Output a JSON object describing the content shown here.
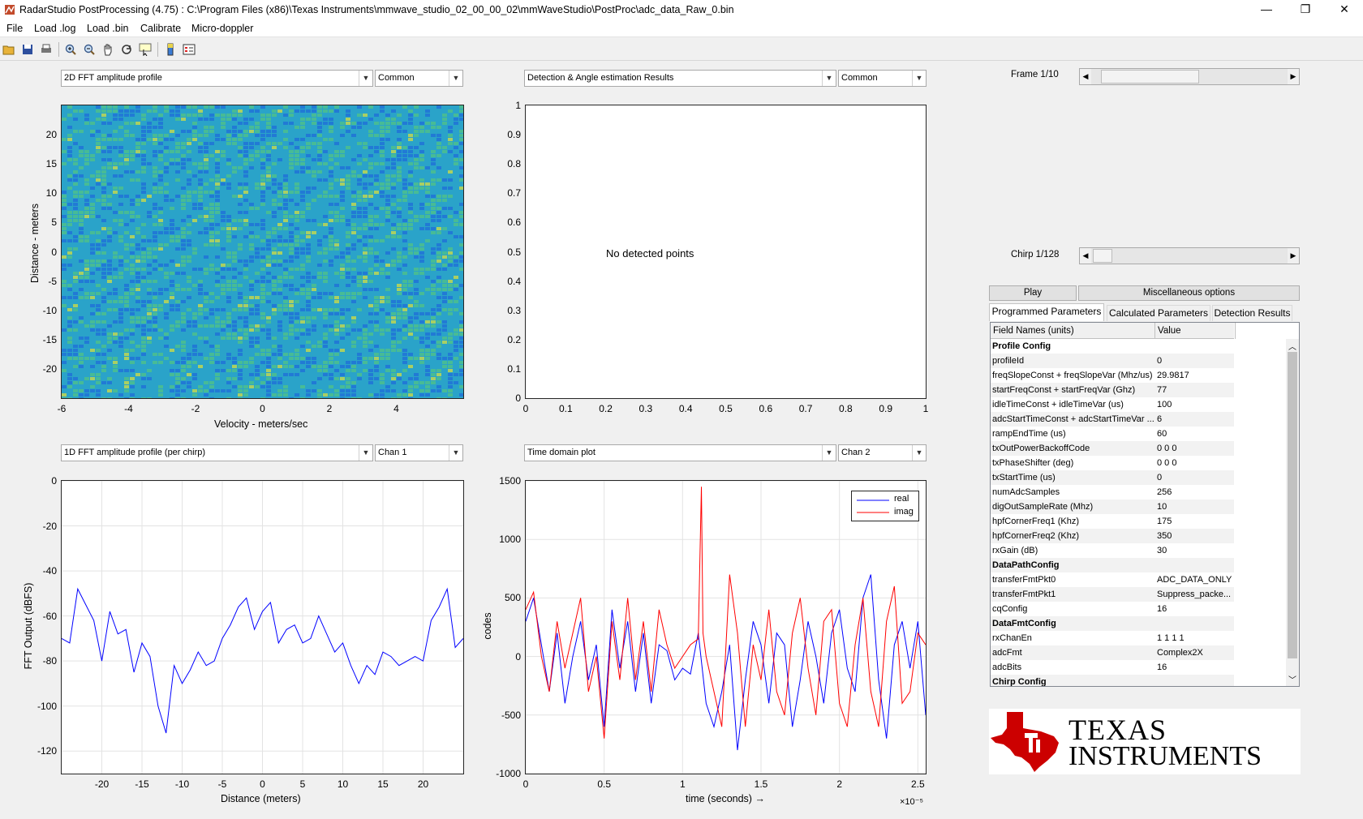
{
  "window": {
    "title": "RadarStudio PostProcessing (4.75)  : C:\\Program Files (x86)\\Texas Instruments\\mmwave_studio_02_00_00_02\\mmWaveStudio\\PostProc\\adc_data_Raw_0.bin",
    "minimize": "—",
    "restore": "❐",
    "close": "✕"
  },
  "menu": [
    "File",
    "Load .log",
    "Load .bin",
    "Calibrate",
    "Micro-doppler"
  ],
  "toolbar": [
    "open-icon",
    "save-icon",
    "print-icon",
    "zoom-in-icon",
    "zoom-out-icon",
    "pan-icon",
    "rotate-icon",
    "data-cursor-icon",
    "colorbar-icon",
    "legend-icon"
  ],
  "panels": {
    "tl": {
      "select": "2D FFT amplitude profile",
      "mode": "Common"
    },
    "tr": {
      "select": "Detection & Angle estimation Results",
      "mode": "Common"
    },
    "bl": {
      "select": "1D FFT amplitude profile (per chirp)",
      "mode": "Chan 1"
    },
    "br": {
      "select": "Time domain plot",
      "mode": "Chan 2"
    }
  },
  "chart_data": [
    {
      "type": "heatmap",
      "title": "",
      "xlabel": "Velocity - meters/sec",
      "ylabel": "Distance - meters",
      "xlim": [
        -6,
        6
      ],
      "ylim": [
        -25,
        25
      ],
      "xticks": [
        -6,
        -4,
        -2,
        0,
        2,
        4
      ],
      "yticks": [
        20,
        15,
        10,
        5,
        0,
        -5,
        -10,
        -15,
        -20
      ],
      "colormap": [
        "#1f6fd8",
        "#2aa3c9",
        "#4fc08a",
        "#c9d94a"
      ]
    },
    {
      "type": "scatter",
      "title": "",
      "annotation": "No detected points",
      "xlim": [
        0,
        1
      ],
      "ylim": [
        0,
        1
      ],
      "xticks": [
        0,
        0.1,
        0.2,
        0.3,
        0.4,
        0.5,
        0.6,
        0.7,
        0.8,
        0.9,
        1
      ],
      "yticks": [
        1,
        0.9,
        0.8,
        0.7,
        0.6,
        0.5,
        0.4,
        0.3,
        0.2,
        0.1,
        0
      ],
      "points": []
    },
    {
      "type": "line",
      "xlabel": "Distance (meters)",
      "ylabel": "FFT Output (dBFS)",
      "xlim": [
        -25,
        25
      ],
      "ylim": [
        -130,
        0
      ],
      "xticks": [
        -20,
        -15,
        -10,
        -5,
        0,
        5,
        10,
        15,
        20
      ],
      "yticks": [
        0,
        -20,
        -40,
        -60,
        -80,
        -100,
        -120
      ],
      "grid": true,
      "series": [
        {
          "color": "#0000ff",
          "x": [
            -25,
            -24,
            -23,
            -22,
            -21,
            -20,
            -19,
            -18,
            -17,
            -16,
            -15,
            -14,
            -13,
            -12,
            -11,
            -10,
            -9,
            -8,
            -7,
            -6,
            -5,
            -4,
            -3,
            -2,
            -1,
            0,
            1,
            2,
            3,
            4,
            5,
            6,
            7,
            8,
            9,
            10,
            11,
            12,
            13,
            14,
            15,
            16,
            17,
            18,
            19,
            20,
            21,
            22,
            23,
            24,
            25
          ],
          "values": [
            -70,
            -72,
            -48,
            -55,
            -62,
            -80,
            -58,
            -68,
            -66,
            -85,
            -72,
            -78,
            -100,
            -112,
            -82,
            -90,
            -84,
            -76,
            -82,
            -80,
            -70,
            -64,
            -56,
            -52,
            -66,
            -58,
            -54,
            -72,
            -66,
            -64,
            -72,
            -70,
            -60,
            -68,
            -76,
            -72,
            -82,
            -90,
            -82,
            -86,
            -76,
            -78,
            -82,
            -80,
            -78,
            -80,
            -62,
            -56,
            -48,
            -74,
            -70
          ]
        }
      ]
    },
    {
      "type": "line",
      "xlabel": "time  (seconds) →",
      "ylabel": "codes",
      "x_multiplier": "×10⁻⁵",
      "xlim": [
        0,
        2.55
      ],
      "ylim": [
        -1000,
        1500
      ],
      "xticks": [
        0,
        0.5,
        1,
        1.5,
        2,
        2.5
      ],
      "yticks": [
        1500,
        1000,
        500,
        0,
        -500,
        -1000
      ],
      "grid": true,
      "legend": "top-right",
      "series": [
        {
          "name": "real",
          "color": "#0000ff",
          "x": [
            0,
            0.05,
            0.1,
            0.15,
            0.2,
            0.25,
            0.3,
            0.35,
            0.4,
            0.45,
            0.5,
            0.55,
            0.6,
            0.65,
            0.7,
            0.75,
            0.8,
            0.85,
            0.9,
            0.95,
            1.0,
            1.05,
            1.1,
            1.15,
            1.2,
            1.25,
            1.3,
            1.35,
            1.4,
            1.45,
            1.5,
            1.55,
            1.6,
            1.65,
            1.7,
            1.75,
            1.8,
            1.85,
            1.9,
            1.95,
            2.0,
            2.05,
            2.1,
            2.15,
            2.2,
            2.25,
            2.3,
            2.35,
            2.4,
            2.45,
            2.5,
            2.55
          ],
          "values": [
            300,
            500,
            100,
            -300,
            200,
            -400,
            0,
            300,
            -200,
            100,
            -600,
            400,
            -100,
            300,
            -300,
            200,
            -400,
            100,
            50,
            -200,
            -100,
            -150,
            200,
            -400,
            -600,
            -300,
            100,
            -800,
            -200,
            300,
            100,
            -400,
            200,
            100,
            -600,
            -200,
            300,
            0,
            -400,
            200,
            400,
            -100,
            -300,
            500,
            700,
            -200,
            -700,
            100,
            300,
            -100,
            300,
            -500
          ]
        },
        {
          "name": "imag",
          "color": "#ff0000",
          "x": [
            0,
            0.05,
            0.1,
            0.15,
            0.2,
            0.25,
            0.3,
            0.35,
            0.4,
            0.45,
            0.5,
            0.55,
            0.6,
            0.65,
            0.7,
            0.75,
            0.8,
            0.85,
            0.9,
            0.95,
            1.0,
            1.05,
            1.1,
            1.12,
            1.13,
            1.15,
            1.2,
            1.25,
            1.3,
            1.35,
            1.4,
            1.45,
            1.5,
            1.55,
            1.6,
            1.65,
            1.7,
            1.75,
            1.8,
            1.85,
            1.9,
            1.95,
            2.0,
            2.05,
            2.1,
            2.15,
            2.2,
            2.25,
            2.3,
            2.35,
            2.4,
            2.45,
            2.5,
            2.55
          ],
          "values": [
            400,
            550,
            0,
            -300,
            300,
            -100,
            200,
            500,
            -300,
            0,
            -700,
            300,
            -200,
            500,
            -200,
            300,
            -300,
            400,
            100,
            -100,
            0,
            100,
            150,
            1450,
            200,
            0,
            -300,
            -600,
            700,
            200,
            -600,
            100,
            -200,
            400,
            -300,
            -500,
            200,
            500,
            -100,
            -500,
            300,
            400,
            -400,
            -600,
            100,
            500,
            -300,
            -600,
            300,
            600,
            -400,
            -300,
            200,
            100
          ]
        }
      ]
    }
  ],
  "right": {
    "frame_label": "Frame 1/10",
    "frame_level": 0.1,
    "chirp_label": "Chirp 1/128",
    "chirp_level": 0.0078,
    "play": "Play",
    "misc": "Miscellaneous options",
    "tabs": [
      "Programmed Parameters",
      "Calculated Parameters",
      "Detection Results"
    ],
    "table": {
      "col1": "Field Names    (units)",
      "col2": "Value",
      "rows": [
        {
          "name": "Profile Config",
          "value": "",
          "header": true
        },
        {
          "name": "profileId",
          "value": "0"
        },
        {
          "name": "freqSlopeConst + freqSlopeVar (Mhz/us)",
          "value": "29.9817"
        },
        {
          "name": "startFreqConst + startFreqVar (Ghz)",
          "value": "77"
        },
        {
          "name": "idleTimeConst + idleTimeVar (us)",
          "value": "100"
        },
        {
          "name": "adcStartTimeConst + adcStartTimeVar ...",
          "value": "6"
        },
        {
          "name": "rampEndTime (us)",
          "value": "60"
        },
        {
          "name": "txOutPowerBackoffCode",
          "value": "0 0 0"
        },
        {
          "name": "txPhaseShifter (deg)",
          "value": "0 0 0"
        },
        {
          "name": "txStartTime (us)",
          "value": "0"
        },
        {
          "name": "numAdcSamples",
          "value": "256"
        },
        {
          "name": "digOutSampleRate (Mhz)",
          "value": "10"
        },
        {
          "name": "hpfCornerFreq1 (Khz)",
          "value": "175"
        },
        {
          "name": "hpfCornerFreq2 (Khz)",
          "value": "350"
        },
        {
          "name": "rxGain (dB)",
          "value": "30"
        },
        {
          "name": "DataPathConfig",
          "value": "",
          "header": true
        },
        {
          "name": "transferFmtPkt0",
          "value": "ADC_DATA_ONLY"
        },
        {
          "name": "transferFmtPkt1",
          "value": "Suppress_packe..."
        },
        {
          "name": "cqConfig",
          "value": "16"
        },
        {
          "name": "DataFmtConfig",
          "value": "",
          "header": true
        },
        {
          "name": "rxChanEn",
          "value": "1 1 1 1"
        },
        {
          "name": "adcFmt",
          "value": "Complex2X"
        },
        {
          "name": "adcBits",
          "value": "16"
        },
        {
          "name": "Chirp Config",
          "value": "",
          "header": true
        }
      ]
    },
    "logo": {
      "line1": "TEXAS",
      "line2": "INSTRUMENTS",
      "color": "#cc0000"
    }
  }
}
